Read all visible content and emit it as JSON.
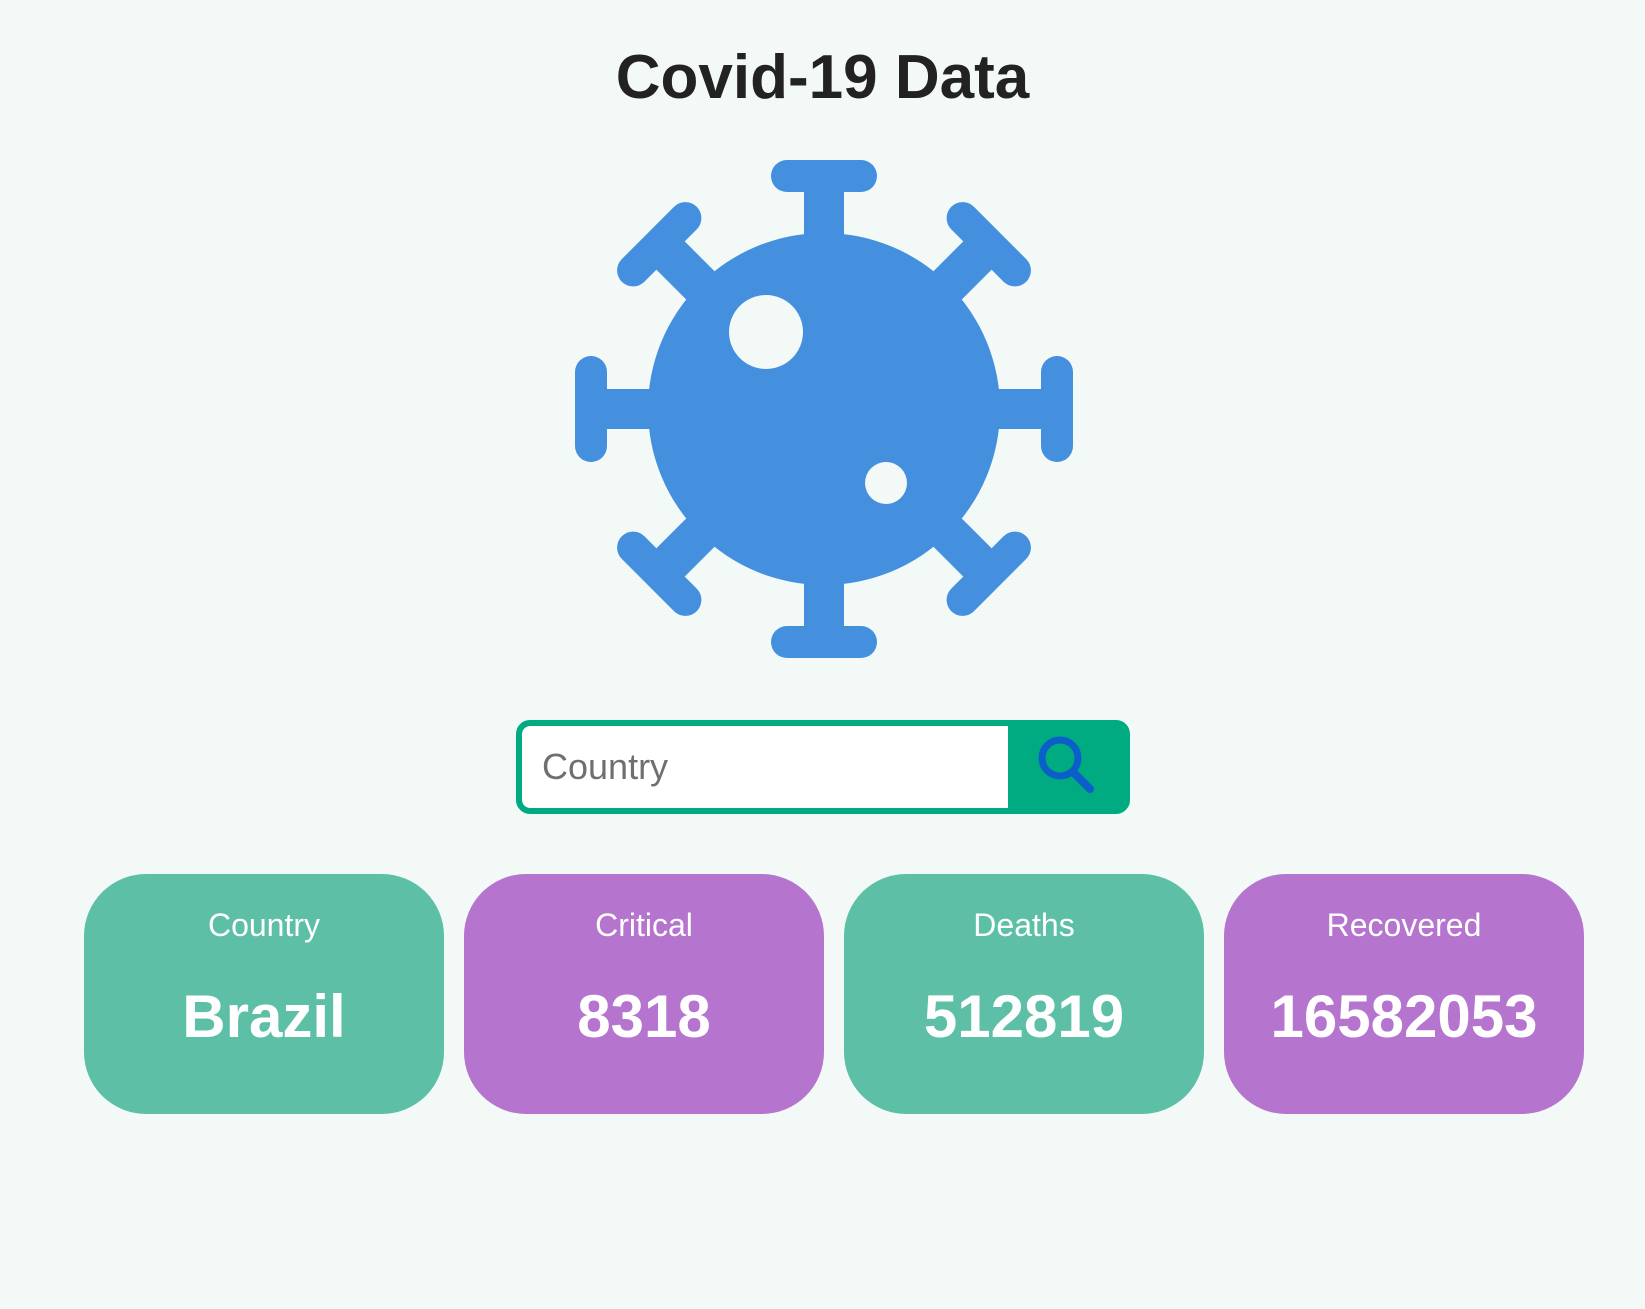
{
  "page": {
    "title": "Covid-19 Data"
  },
  "colors": {
    "background": "#f3f9f7",
    "virus": "#458fdf",
    "search_accent": "#00ab82",
    "search_icon": "#0b5fc8",
    "card_green": "#5dc0a6",
    "card_purple": "#b574ce"
  },
  "hero_icon": "virus-icon",
  "search": {
    "placeholder": "Country",
    "value": "",
    "button_icon": "search-icon"
  },
  "stats": [
    {
      "label": "Country",
      "value": "Brazil",
      "color": "green"
    },
    {
      "label": "Critical",
      "value": "8318",
      "color": "purple"
    },
    {
      "label": "Deaths",
      "value": "512819",
      "color": "green"
    },
    {
      "label": "Recovered",
      "value": "16582053",
      "color": "purple"
    }
  ]
}
